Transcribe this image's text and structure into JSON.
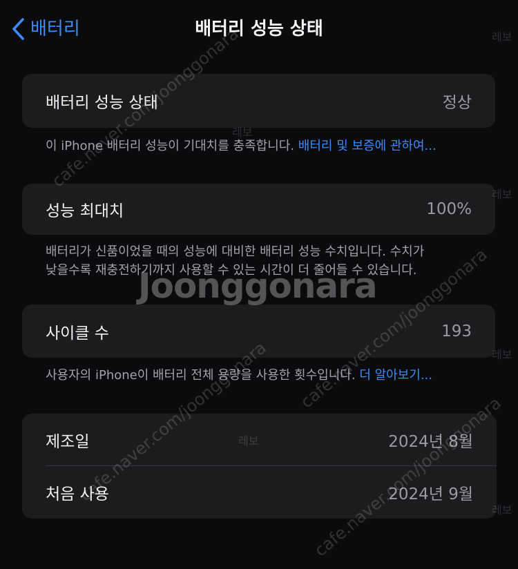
{
  "nav": {
    "back_label": "배터리",
    "title": "배터리 성능 상태"
  },
  "health": {
    "label": "배터리 성능 상태",
    "value": "정상",
    "footnote_text": "이 iPhone 배터리 성능이 기대치를 충족합니다.",
    "footnote_link": "배터리 및 보증에 관하여..."
  },
  "max_capacity": {
    "label": "성능 최대치",
    "value": "100%",
    "footnote_line1": "배터리가 신품이었을 때의 성능에 대비한 배터리 성능 수치입니다. 수치가",
    "footnote_line2": "낮을수록 재충전하기까지 사용할 수 있는 시간이 더 줄어들 수 있습니다."
  },
  "cycle": {
    "label": "사이클 수",
    "value": "193",
    "footnote_text": "사용자의 iPhone이 배터리 전체 용량을 사용한 횟수입니다.",
    "footnote_link": "더 알아보기..."
  },
  "dates": {
    "manufacture_label": "제조일",
    "manufacture_value": "2024년 8월",
    "first_use_label": "처음 사용",
    "first_use_value": "2024년 9월"
  },
  "watermark": {
    "logo": "Joonggonara",
    "url": "cafe.naver.com/joonggonara",
    "tag": "레보"
  },
  "colors": {
    "accent": "#3a8bf7",
    "background": "#0b0b0e",
    "card": "#1c1c1f"
  }
}
